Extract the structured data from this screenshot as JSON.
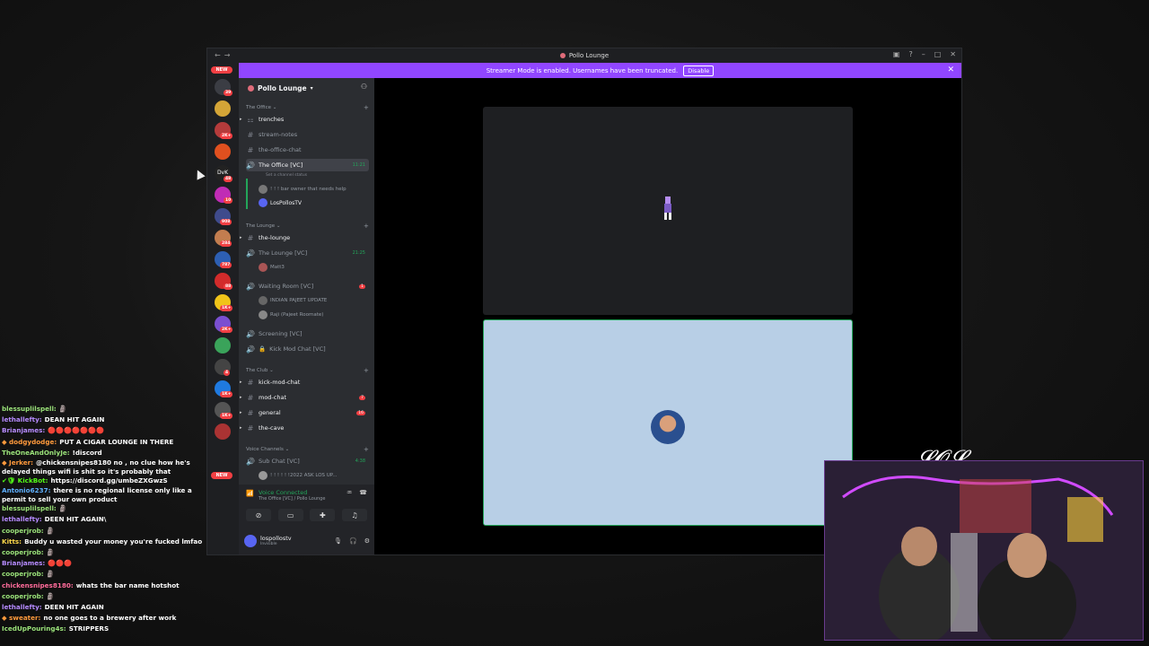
{
  "window": {
    "title": "Pollo Lounge"
  },
  "banner": {
    "text": "Streamer Mode is enabled. Usernames have been truncated.",
    "button": "Disable"
  },
  "server_rail": {
    "new_badge": "NEW",
    "badges": [
      "39",
      "2K+",
      "48",
      "10",
      "908",
      "284",
      "787",
      "88",
      "1K+",
      "2K+",
      "4",
      "1K+",
      "1K+"
    ]
  },
  "guild": {
    "name": "Pollo Lounge"
  },
  "categories": {
    "office": "The Office",
    "lounge": "The Lounge",
    "club": "The Club",
    "voice": "Voice Channels"
  },
  "channels": {
    "trenches": "trenches",
    "stream_notes": "stream-notes",
    "office_chat": "the-office-chat",
    "office_vc": "The Office [VC]",
    "office_vc_time": "11:21",
    "office_vc_status": "Set a channel status",
    "office_user1": "! ! ! bar owner that needs help",
    "office_user2": "LosPollosTV",
    "the_lounge": "the-lounge",
    "lounge_vc": "The Lounge [VC]",
    "lounge_vc_time": "21:25",
    "lounge_user": "Matt3",
    "waiting_vc": "Waiting Room [VC]",
    "waiting_badge": "1",
    "waiting_user1": "INDIAN PAJEET UPDATE",
    "waiting_user2": "Raji (Pajeet Roomate)",
    "screening_vc": "Screening [VC]",
    "kick_mod_vc": "Kick Mod Chat [VC]",
    "kick_mod_chat": "kick-mod-chat",
    "mod_chat": "mod-chat",
    "mod_badge": "7",
    "general": "general",
    "general_badge": "16",
    "the_cave": "the-cave",
    "sub_chat": "Sub Chat [VC]",
    "sub_time": "4:38",
    "sub_user": "! ! ! ! ! !2022 ASK LOS UP..."
  },
  "voice": {
    "status": "Voice Connected",
    "location": "The Office [VC] / Pollo Lounge"
  },
  "user": {
    "name": "lospollostv",
    "status": "Invisible"
  },
  "chat": [
    {
      "name": "blessuplilspell:",
      "text": "🗿",
      "color": "#9be37a"
    },
    {
      "name": "lethallefty:",
      "text": "DEAN HIT AGAIN",
      "color": "#b68bff"
    },
    {
      "name": "Brianjames:",
      "text": "🔴🔴🔴🔴🔴🔴🔴",
      "color": "#b68bff"
    },
    {
      "name": "◆ dodgydodge:",
      "text": "PUT A CIGAR LOUNGE IN THERE",
      "color": "#ff9a3c"
    },
    {
      "name": "TheOneAndOnlyJe:",
      "text": "!discord",
      "color": "#9be37a"
    },
    {
      "name": "◆ Jerker:",
      "text": "@chickensnipes8180 no , no clue how he's delayed things wifi is shit so it's probably that",
      "color": "#ff9a3c"
    },
    {
      "name": "✔🛡 KickBot:",
      "text": "https://discord.gg/umbeZXGwzS",
      "color": "#53fc18"
    },
    {
      "name": "Antonio6237:",
      "text": "there is no regional license only like a permit to sell your own product",
      "color": "#5fb0ff"
    },
    {
      "name": "blessuplilspell:",
      "text": "🗿",
      "color": "#9be37a"
    },
    {
      "name": "lethallefty:",
      "text": "DEEN HIT AGAIN\\",
      "color": "#b68bff"
    },
    {
      "name": "cooperjrob:",
      "text": "🗿",
      "color": "#9be37a"
    },
    {
      "name": "Kitts:",
      "text": "Buddy u wasted your money you're fucked lmfao",
      "color": "#ffd84a"
    },
    {
      "name": "cooperjrob:",
      "text": "🗿",
      "color": "#9be37a"
    },
    {
      "name": "Brianjames:",
      "text": "🔴🔴🔴",
      "color": "#b68bff"
    },
    {
      "name": "cooperjrob:",
      "text": "🗿",
      "color": "#9be37a"
    },
    {
      "name": "chickensnipes8180:",
      "text": "whats the bar name hotshot",
      "color": "#ff6b9a"
    },
    {
      "name": "cooperjrob:",
      "text": "🗿",
      "color": "#9be37a"
    },
    {
      "name": "lethallefty:",
      "text": "DEEN HIT AGAIN",
      "color": "#b68bff"
    },
    {
      "name": "◆ sweater:",
      "text": "no one goes to a brewery after work",
      "color": "#ff9a3c"
    },
    {
      "name": "IcedUpPouring4s:",
      "text": "STRIPPERS",
      "color": "#9be37a"
    }
  ]
}
